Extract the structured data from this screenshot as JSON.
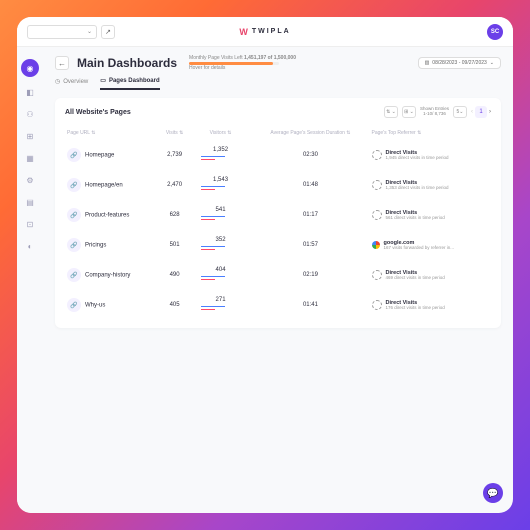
{
  "brand": "TWIPLA",
  "avatar": "SC",
  "header": {
    "title": "Main Dashboards",
    "quota_label": "Monthly Page Visits Left",
    "quota_value": "1,451,197 of 1,500,000",
    "quota_hover": "Hover for details",
    "date_range": "08/28/2023 - 09/27/2023"
  },
  "tabs": {
    "overview": "Overview",
    "pages": "Pages Dashboard"
  },
  "card": {
    "title": "All Website's Pages",
    "shown_label": "Shown Entries",
    "shown_value": "1-10/ 8,736",
    "page_size": "5",
    "page_num": "1"
  },
  "columns": {
    "url": "Page URL",
    "visits": "Visits",
    "visitors": "Visitors",
    "duration": "Average Page's Session Duration",
    "referrer": "Page's Top Referrer"
  },
  "rows": [
    {
      "url": "Homepage",
      "visits": "2,739",
      "visitors": "1,352",
      "duration": "02:30",
      "ref_type": "direct",
      "ref_title": "Direct Visits",
      "ref_sub": "1,945 direct visits in time period"
    },
    {
      "url": "Homepage/en",
      "visits": "2,470",
      "visitors": "1,543",
      "duration": "01:48",
      "ref_type": "direct",
      "ref_title": "Direct Visits",
      "ref_sub": "1,353 direct visits in time period"
    },
    {
      "url": "Product-features",
      "visits": "628",
      "visitors": "541",
      "duration": "01:17",
      "ref_type": "direct",
      "ref_title": "Direct Visits",
      "ref_sub": "561 direct visits in time period"
    },
    {
      "url": "Pricings",
      "visits": "501",
      "visitors": "352",
      "duration": "01:57",
      "ref_type": "google",
      "ref_title": "google.com",
      "ref_sub": "167 visits forwarded by referrer in..."
    },
    {
      "url": "Company-history",
      "visits": "490",
      "visitors": "404",
      "duration": "02:19",
      "ref_type": "direct",
      "ref_title": "Direct Visits",
      "ref_sub": "469 direct visits in time period"
    },
    {
      "url": "Why-us",
      "visits": "405",
      "visitors": "271",
      "duration": "01:41",
      "ref_type": "direct",
      "ref_title": "Direct Visits",
      "ref_sub": "176 direct visits in time period"
    }
  ]
}
